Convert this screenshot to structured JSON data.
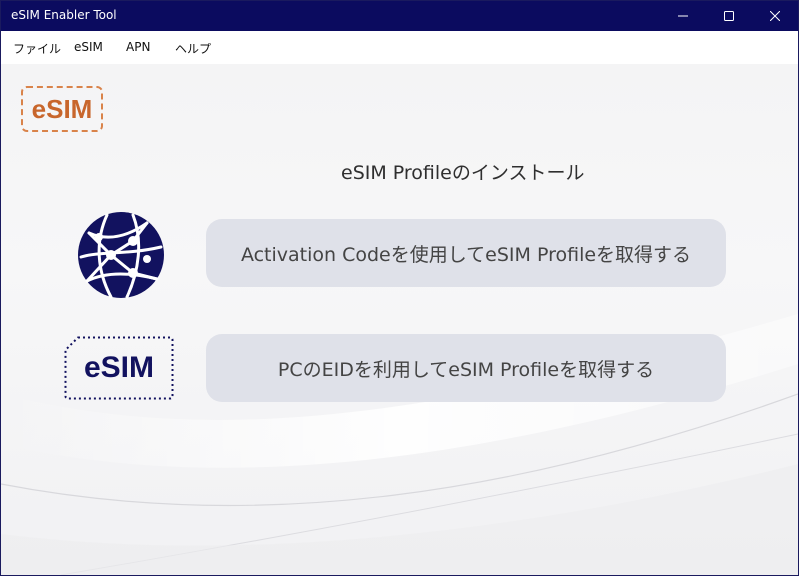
{
  "window": {
    "title": "eSIM Enabler Tool"
  },
  "menu": {
    "items": [
      "ファイル",
      "eSIM",
      "APN",
      "ヘルプ"
    ]
  },
  "logo": {
    "text": "eSIM",
    "color": "#c8662c"
  },
  "main": {
    "section_title": "eSIM Profileのインストール",
    "activation_button_label": "Activation Codeを使用してeSIM Profileを取得する",
    "eid_button_label": "PCのEIDを利用してeSIM Profileを取得する",
    "esim_card_text": "eSIM"
  },
  "colors": {
    "titlebar": "#0b0b5f",
    "button_bg": "#dfe1e9",
    "brand_navy": "#12125f",
    "brand_orange": "#d9834a"
  },
  "icons": {
    "minimize": "minimize-icon",
    "maximize": "maximize-icon",
    "close": "close-icon",
    "globe": "globe-network-icon",
    "esim_card": "esim-card-icon"
  }
}
